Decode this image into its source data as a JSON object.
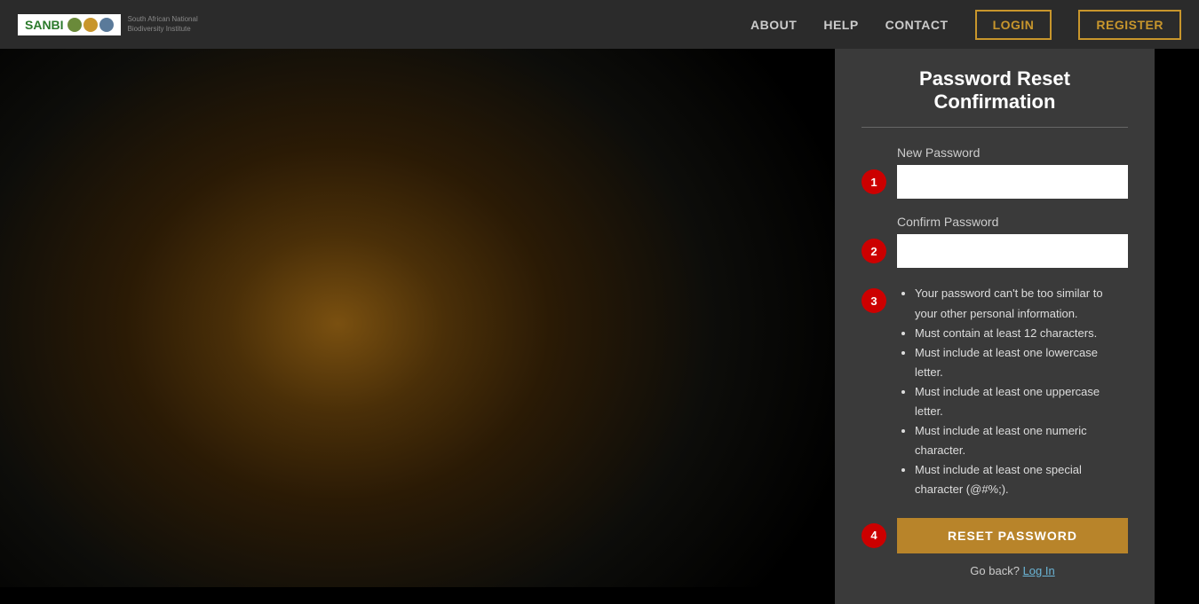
{
  "navbar": {
    "logo_text": "SANBI",
    "logo_subtitle_line1": "South African National",
    "logo_subtitle_line2": "Biodiversity Institute",
    "nav_links": [
      {
        "label": "ABOUT",
        "id": "about"
      },
      {
        "label": "HELP",
        "id": "help"
      },
      {
        "label": "CONTACT",
        "id": "contact"
      }
    ],
    "login_label": "LOGIN",
    "register_label": "REGISTER"
  },
  "card": {
    "title": "Password Reset Confirmation",
    "new_password_label": "New Password",
    "new_password_placeholder": "",
    "confirm_password_label": "Confirm Password",
    "confirm_password_placeholder": "",
    "requirements": [
      "Your password can't be too similar to your other personal information.",
      "Must contain at least 12 characters.",
      "Must include at least one lowercase letter.",
      "Must include at least one uppercase letter.",
      "Must include at least one numeric character.",
      "Must include at least one special character (@#%;)."
    ],
    "reset_button_label": "RESET PASSWORD",
    "go_back_text": "Go back?",
    "login_link_text": "Log In",
    "steps": {
      "new_password": "1",
      "confirm_password": "2",
      "requirements": "3",
      "reset_button": "4"
    }
  }
}
